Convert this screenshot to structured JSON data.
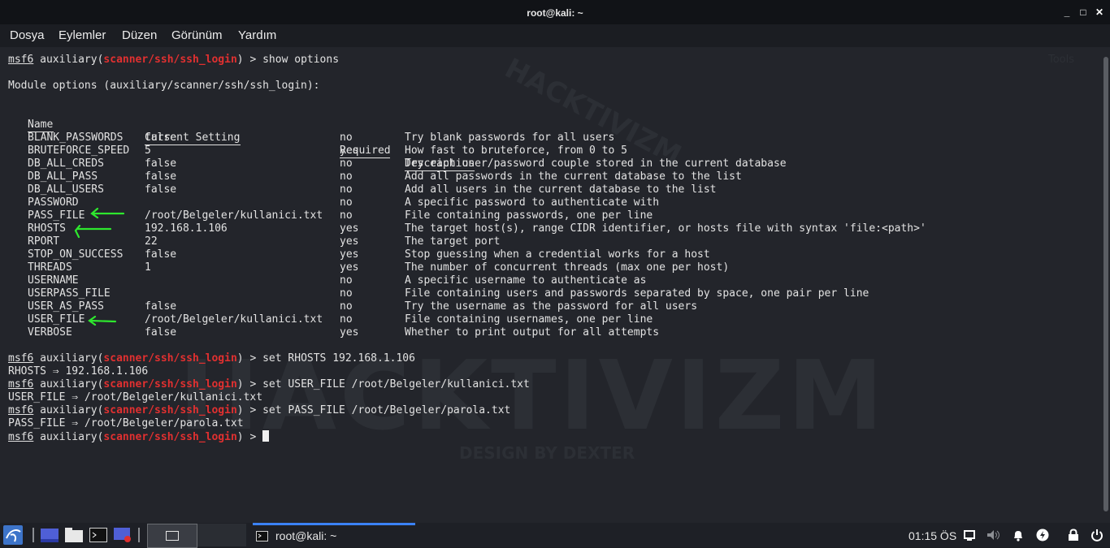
{
  "window": {
    "title": "root@kali: ~",
    "min": "_",
    "max": "□",
    "close": "✕"
  },
  "menu": [
    "Dosya",
    "Eylemler",
    "Düzen",
    "Görünüm",
    "Yardım"
  ],
  "watermark": {
    "top": "HACKTIVIZM",
    "big": "HACKTIVIZM",
    "sub": "DESIGN BY DEXTER",
    "tools": "Tools"
  },
  "prompt": {
    "user": "msf6",
    "mod_pre": "auxiliary(",
    "module": "scanner/ssh/ssh_login",
    "mod_post": ")",
    "sym": " > "
  },
  "terminal": {
    "cmd1": "show options",
    "module_options": "Module options (auxiliary/scanner/ssh/ssh_login):",
    "headers": [
      "Name",
      "Current Setting",
      "Required",
      "Description"
    ],
    "rows": [
      [
        "BLANK_PASSWORDS",
        "false",
        "no",
        "Try blank passwords for all users"
      ],
      [
        "BRUTEFORCE_SPEED",
        "5",
        "yes",
        "How fast to bruteforce, from 0 to 5"
      ],
      [
        "DB_ALL_CREDS",
        "false",
        "no",
        "Try each user/password couple stored in the current database"
      ],
      [
        "DB_ALL_PASS",
        "false",
        "no",
        "Add all passwords in the current database to the list"
      ],
      [
        "DB_ALL_USERS",
        "false",
        "no",
        "Add all users in the current database to the list"
      ],
      [
        "PASSWORD",
        "",
        "no",
        "A specific password to authenticate with"
      ],
      [
        "PASS_FILE",
        "/root/Belgeler/kullanici.txt",
        "no",
        "File containing passwords, one per line"
      ],
      [
        "RHOSTS",
        "192.168.1.106",
        "yes",
        "The target host(s), range CIDR identifier, or hosts file with syntax 'file:<path>'"
      ],
      [
        "RPORT",
        "22",
        "yes",
        "The target port"
      ],
      [
        "STOP_ON_SUCCESS",
        "false",
        "yes",
        "Stop guessing when a credential works for a host"
      ],
      [
        "THREADS",
        "1",
        "yes",
        "The number of concurrent threads (max one per host)"
      ],
      [
        "USERNAME",
        "",
        "no",
        "A specific username to authenticate as"
      ],
      [
        "USERPASS_FILE",
        "",
        "no",
        "File containing users and passwords separated by space, one pair per line"
      ],
      [
        "USER_AS_PASS",
        "false",
        "no",
        "Try the username as the password for all users"
      ],
      [
        "USER_FILE",
        "/root/Belgeler/kullanici.txt",
        "no",
        "File containing usernames, one per line"
      ],
      [
        "VERBOSE",
        "false",
        "yes",
        "Whether to print output for all attempts"
      ]
    ],
    "cmd2": "set RHOSTS 192.168.1.106",
    "out2": "RHOSTS ⇒ 192.168.1.106",
    "cmd3": "set USER_FILE /root/Belgeler/kullanici.txt",
    "out3": "USER_FILE ⇒ /root/Belgeler/kullanici.txt",
    "cmd4": "set PASS_FILE /root/Belgeler/parola.txt",
    "out4": "PASS_FILE ⇒ /root/Belgeler/parola.txt"
  },
  "taskbar": {
    "window_label": "root@kali: ~",
    "clock": "01:15 ÖS"
  },
  "colors": {
    "prompt_module": "#e13030",
    "annotation_arrow": "#2ee82e",
    "terminal_bg": "#23252b",
    "task_active": "#3b82f6"
  }
}
